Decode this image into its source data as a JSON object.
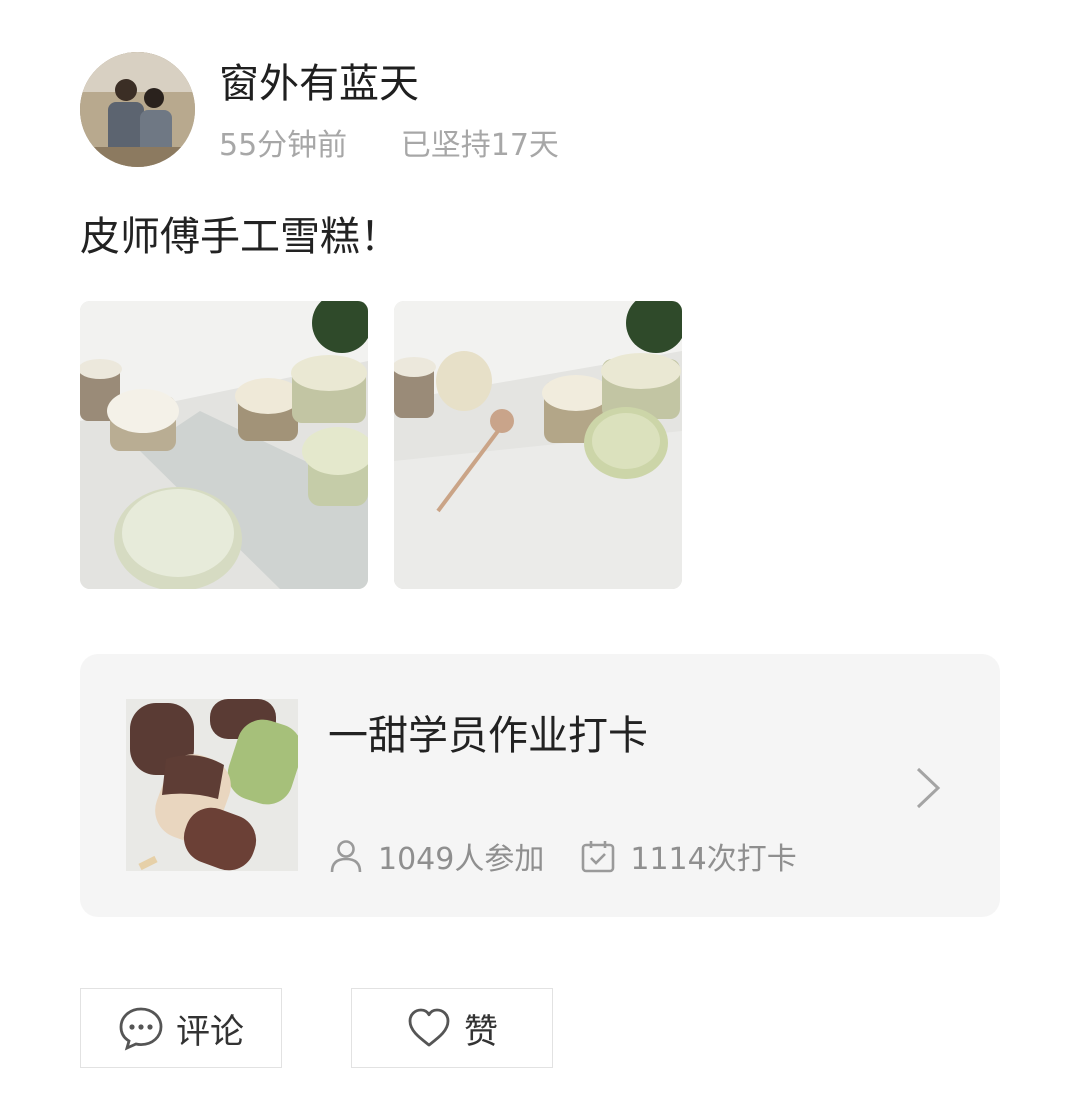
{
  "user": {
    "name": "窗外有蓝天",
    "time_ago": "55分钟前",
    "streak": "已坚持17天",
    "avatar_icon": "avatar-photo"
  },
  "post": {
    "text": "皮师傅手工雪糕！",
    "photos": [
      {
        "icon": "ice-cream-cups-photo"
      },
      {
        "icon": "ice-cream-cups-spoon-photo"
      }
    ]
  },
  "group": {
    "title": "一甜学员作业打卡",
    "participants": "1049人参加",
    "checkins": "1114次打卡",
    "participants_icon": "person-icon",
    "checkins_icon": "calendar-check-icon",
    "chevron_icon": "chevron-right-icon"
  },
  "actions": {
    "comment_label": "评论",
    "like_label": "赞",
    "comment_icon": "comment-bubble-icon",
    "like_icon": "heart-icon"
  },
  "colors": {
    "name": "#1f1f1f",
    "meta": "#a7a7a7",
    "card_bg": "#f5f5f5",
    "stat_text": "#8f8f8f"
  }
}
